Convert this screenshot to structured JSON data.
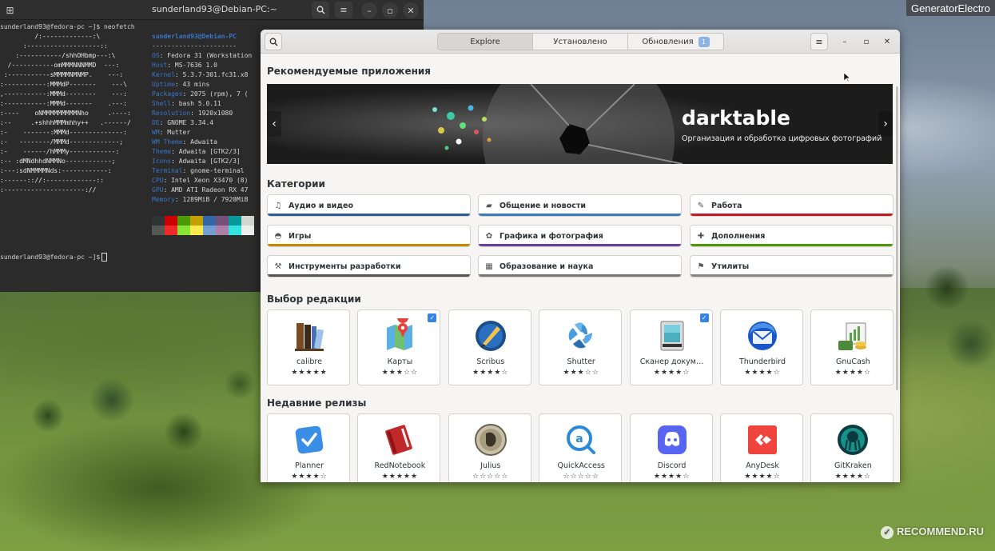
{
  "watermark_top": "GeneratorElectro",
  "watermark_bottom": "RECOMMEND.RU",
  "terminal": {
    "title": "sunderland93@Debian-PC:~",
    "prompt1": "sunderland93@fedora-pc ~]$ neofetch",
    "prompt2": "sunderland93@fedora-pc ~]$",
    "user_host": "sunderland93@Debian-PC",
    "separator": "----------------------",
    "logo": [
      "         /:-------------:\\",
      "      :-------------------::",
      "    :-----------/shhOHbmp---:\\",
      "  /-----------omMMMNNNMMD  ---:",
      " :-----------sMMMMNMNMP.    ---:",
      ":-----------:MMMdP-------    ---\\",
      ",-----------:MMMd--------    ---:",
      ":-----------:MMMd-------    .---:",
      ":----    oNMMMMMMMMMNho     .----:",
      ":--     .+shhhMMMmhhy++   .------/",
      ":-    -------:MMMd--------------:",
      ":-   --------/MMMd-------------;",
      ":-    ------/hMMMy------------:",
      ":-- :dMNdhhdNMMNo------------;",
      ":---:sdNMMMMNds:------------:",
      ":------:://:-------------::",
      ":---------------------://"
    ],
    "info": [
      {
        "key": "OS",
        "value": "Fedora 31 (Workstation"
      },
      {
        "key": "Host",
        "value": "MS-7636 1.0"
      },
      {
        "key": "Kernel",
        "value": "5.3.7-301.fc31.x8"
      },
      {
        "key": "Uptime",
        "value": "43 mins"
      },
      {
        "key": "Packages",
        "value": "2075 (rpm), 7 ("
      },
      {
        "key": "Shell",
        "value": "bash 5.0.11"
      },
      {
        "key": "Resolution",
        "value": "1920x1080"
      },
      {
        "key": "DE",
        "value": "GNOME 3.34.4"
      },
      {
        "key": "WM",
        "value": "Mutter"
      },
      {
        "key": "WM Theme",
        "value": "Adwaita"
      },
      {
        "key": "Theme",
        "value": "Adwaita [GTK2/3]"
      },
      {
        "key": "Icons",
        "value": "Adwaita [GTK2/3]"
      },
      {
        "key": "Terminal",
        "value": "gnome-terminal"
      },
      {
        "key": "CPU",
        "value": "Intel Xeon X3470 (8)"
      },
      {
        "key": "GPU",
        "value": "AMD ATI Radeon RX 47"
      },
      {
        "key": "Memory",
        "value": "1289MiB / 7920MiB"
      }
    ],
    "palette_top": [
      "#2e3436",
      "#cc0000",
      "#4e9a06",
      "#c4a000",
      "#3465a4",
      "#75507b",
      "#06989a",
      "#d3d7cf"
    ],
    "palette_bottom": [
      "#555753",
      "#ef2929",
      "#8ae234",
      "#fce94f",
      "#729fcf",
      "#ad7fa8",
      "#34e2e2",
      "#eeeeec"
    ]
  },
  "software": {
    "tabs": [
      "Explore",
      "Установлено",
      "Обновления"
    ],
    "updates_badge": "1",
    "featured_title": "Рекомендуемые приложения",
    "banner": {
      "title": "darktable",
      "subtitle": "Организация и обработка цифровых фотографий"
    },
    "categories_title": "Категории",
    "categories": [
      {
        "label": "Аудио и видео",
        "icon": "music-note-icon",
        "color": "#2a5b9c"
      },
      {
        "label": "Общение и новости",
        "icon": "chat-bubble-icon",
        "color": "#3c7bbf"
      },
      {
        "label": "Работа",
        "icon": "pencil-square-icon",
        "color": "#c01c28"
      },
      {
        "label": "Игры",
        "icon": "gamepad-icon",
        "color": "#c88800"
      },
      {
        "label": "Графика и фотография",
        "icon": "palette-icon",
        "color": "#6b3fa0"
      },
      {
        "label": "Дополнения",
        "icon": "puzzle-icon",
        "color": "#4e9a06"
      },
      {
        "label": "Инструменты разработки",
        "icon": "tools-icon",
        "color": "#555555"
      },
      {
        "label": "Образование и наука",
        "icon": "book-icon",
        "color": "#777777"
      },
      {
        "label": "Утилиты",
        "icon": "utility-icon",
        "color": "#888888"
      }
    ],
    "editors_title": "Выбор редакции",
    "editors_apps": [
      {
        "name": "calibre",
        "stars": "★★★★★",
        "checked": false
      },
      {
        "name": "Карты",
        "stars": "★★★☆☆",
        "checked": true
      },
      {
        "name": "Scribus",
        "stars": "★★★★☆",
        "checked": false
      },
      {
        "name": "Shutter",
        "stars": "★★★☆☆",
        "checked": false
      },
      {
        "name": "Сканер докум…",
        "stars": "★★★★☆",
        "checked": true
      },
      {
        "name": "Thunderbird",
        "stars": "★★★★☆",
        "checked": false
      },
      {
        "name": "GnuCash",
        "stars": "★★★★☆",
        "checked": false
      }
    ],
    "recent_title": "Недавние релизы",
    "recent_apps": [
      {
        "name": "Planner",
        "stars": "★★★★☆"
      },
      {
        "name": "RedNotebook",
        "stars": "★★★★★"
      },
      {
        "name": "Julius",
        "stars": "☆☆☆☆☆"
      },
      {
        "name": "QuickAccess",
        "stars": "☆☆☆☆☆"
      },
      {
        "name": "Discord",
        "stars": "★★★★☆"
      },
      {
        "name": "AnyDesk",
        "stars": "★★★★☆"
      },
      {
        "name": "GitKraken",
        "stars": "★★★★☆"
      }
    ]
  }
}
